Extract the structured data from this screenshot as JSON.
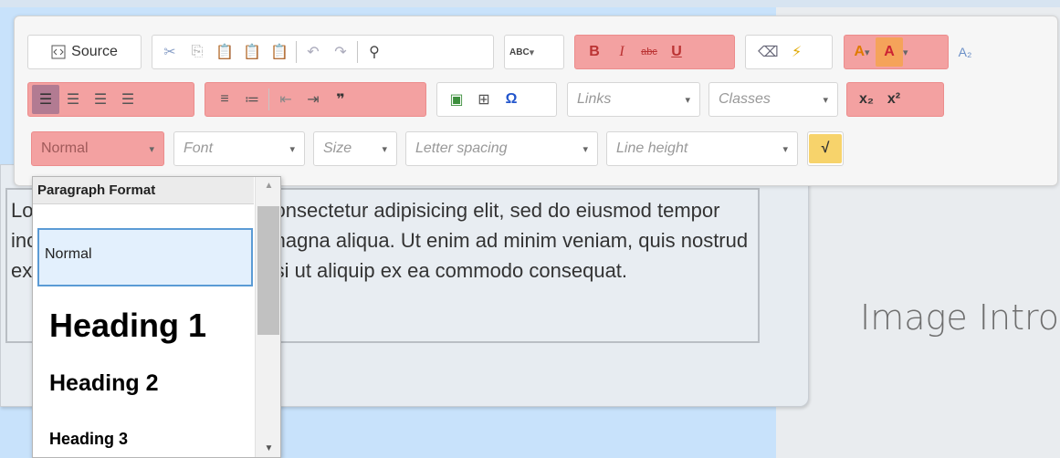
{
  "toolbar": {
    "row1": {
      "source_label": "Source",
      "spellcheck_label": "ABC",
      "bold_label": "B",
      "italic_label": "I",
      "strike_label": "abc",
      "underline_label": "U",
      "font_color_label": "A",
      "bg_color_label": "A",
      "font_size_toggle_label": "A₂"
    },
    "row2": {
      "links_placeholder": "Links",
      "classes_placeholder": "Classes",
      "subscript_label": "x₂",
      "superscript_label": "x²"
    },
    "row3": {
      "format_value": "Normal",
      "font_placeholder": "Font",
      "size_placeholder": "Size",
      "letter_spacing_placeholder": "Letter spacing",
      "line_height_placeholder": "Line height",
      "math_label": "√"
    }
  },
  "dropdown": {
    "title": "Paragraph Format",
    "items": [
      "Normal",
      "Heading 1",
      "Heading 2",
      "Heading 3"
    ]
  },
  "editor": {
    "text": "Lorem ipsum dolor sit amet, consectetur adipisicing elit, sed do eiusmod tempor incididunt ut labore et dolore magna aliqua. Ut enim ad minim veniam, quis nostrud exercitation ullamco laboris nisi ut aliquip ex ea commodo consequat."
  },
  "right_panel": {
    "heading": "Image Intro"
  },
  "colors": {
    "highlight": "#f3a1a1",
    "selected_align": "#b27b92",
    "selection_border": "#5b9bd5"
  }
}
